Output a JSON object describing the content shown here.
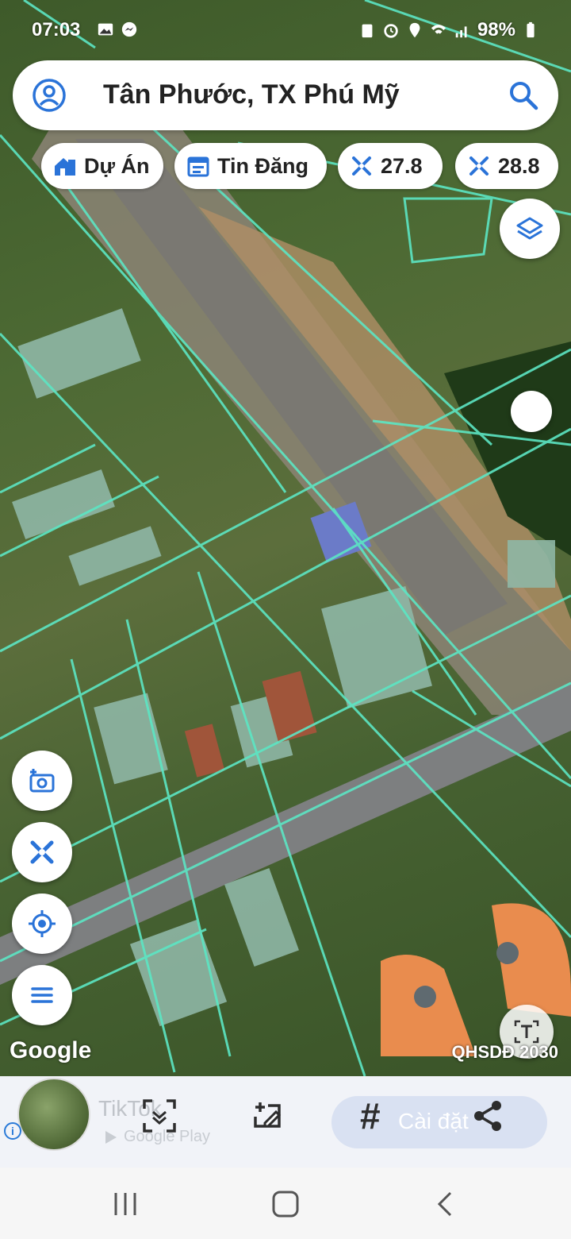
{
  "status_bar": {
    "time": "07:03",
    "battery": "98%",
    "left_icons": [
      "gallery-icon",
      "messenger-icon"
    ],
    "right_icons": [
      "clipboard-icon",
      "alarm-icon",
      "location-icon",
      "wifi-icon",
      "signal-icon",
      "battery-icon"
    ]
  },
  "search": {
    "query": "Tân Phước, TX Phú Mỹ"
  },
  "chips": [
    {
      "label": "Dự Án",
      "icon": "project-house-icon"
    },
    {
      "label": "Tin Đăng",
      "icon": "calendar-icon"
    },
    {
      "label": "27.8",
      "icon": "measure-icon"
    },
    {
      "label": "28.8",
      "icon": "measure-icon"
    }
  ],
  "map": {
    "attribution": "Google",
    "plan_label": "QHSDĐ 2030",
    "parcel_line_color": "#5ce6c4",
    "accent": "#2a73d8"
  },
  "side_tools": [
    "camera-add-icon",
    "ruler-measure-icon",
    "my-location-icon",
    "menu-icon"
  ],
  "bottom_bar": {
    "ad_text": "TikTok",
    "ad_store": "Google Play",
    "settings_label": "Cài đặt",
    "hash_symbol": "#"
  },
  "nav_bar": [
    "recents-button",
    "home-button",
    "back-button"
  ]
}
